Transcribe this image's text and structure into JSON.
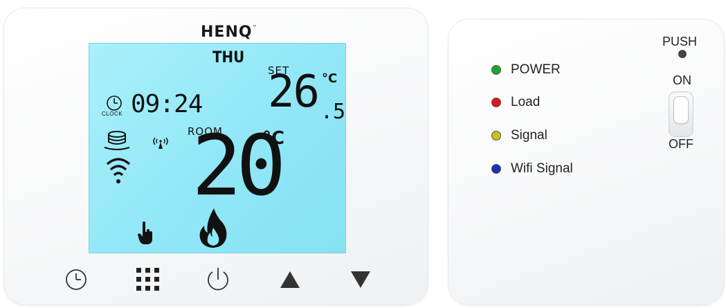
{
  "thermostat": {
    "brand": "HENQ",
    "brand_tm": "™",
    "display": {
      "day": "THU",
      "set_label": "SET",
      "set_temp": "26",
      "set_temp_decimal": ".5",
      "set_unit": "°C",
      "clock_label": "CLOCK",
      "time": "09:24",
      "room_label": "ROOM",
      "room_temp": "20",
      "room_unit": "°C",
      "icons": [
        "clock-icon",
        "floor-heating-icon",
        "wifi-icon",
        "antenna-icon",
        "manual-hand-icon",
        "flame-icon"
      ]
    },
    "buttons": [
      "clock-button",
      "menu-button",
      "power-button",
      "up-button",
      "down-button"
    ]
  },
  "receiver": {
    "leds": [
      {
        "label": "POWER",
        "color": "#1fa52a"
      },
      {
        "label": "Load",
        "color": "#e0141e"
      },
      {
        "label": "Signal",
        "color": "#c9c21a"
      },
      {
        "label": "Wifi Signal",
        "color": "#1a2fb8"
      }
    ],
    "push_label": "PUSH",
    "on_label": "ON",
    "off_label": "OFF"
  }
}
